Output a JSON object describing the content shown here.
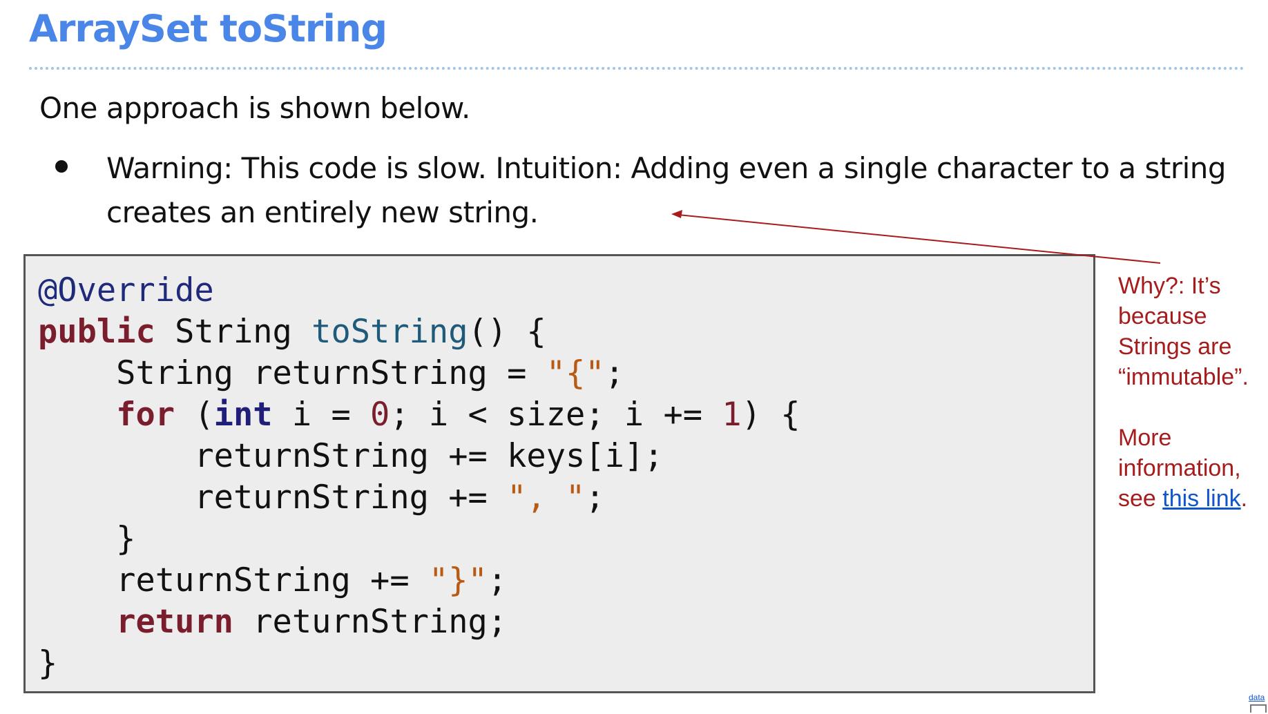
{
  "slide": {
    "title": "ArraySet toString",
    "intro": "One approach is shown below.",
    "bullets": [
      "Warning: This code is slow. Intuition: Adding even a single character to a string creates an entirely new string."
    ]
  },
  "code": {
    "lines": [
      [
        {
          "t": "annotation",
          "s": "@Override"
        }
      ],
      [
        {
          "t": "keyword",
          "s": "public"
        },
        {
          "t": "plain",
          "s": " String "
        },
        {
          "t": "method",
          "s": "toString"
        },
        {
          "t": "plain",
          "s": "() {"
        }
      ],
      [
        {
          "t": "plain",
          "s": "    String returnString = "
        },
        {
          "t": "string",
          "s": "\"{\""
        },
        {
          "t": "plain",
          "s": ";"
        }
      ],
      [
        {
          "t": "plain",
          "s": "    "
        },
        {
          "t": "keyword",
          "s": "for"
        },
        {
          "t": "plain",
          "s": " ("
        },
        {
          "t": "type",
          "s": "int"
        },
        {
          "t": "plain",
          "s": " i = "
        },
        {
          "t": "number",
          "s": "0"
        },
        {
          "t": "plain",
          "s": "; i < size; i += "
        },
        {
          "t": "number",
          "s": "1"
        },
        {
          "t": "plain",
          "s": ") {"
        }
      ],
      [
        {
          "t": "plain",
          "s": "        returnString += keys[i];"
        }
      ],
      [
        {
          "t": "plain",
          "s": "        returnString += "
        },
        {
          "t": "string",
          "s": "\", \""
        },
        {
          "t": "plain",
          "s": ";"
        }
      ],
      [
        {
          "t": "plain",
          "s": "    }"
        }
      ],
      [
        {
          "t": "plain",
          "s": "    returnString += "
        },
        {
          "t": "string",
          "s": "\"}\""
        },
        {
          "t": "plain",
          "s": ";"
        }
      ],
      [
        {
          "t": "plain",
          "s": "    "
        },
        {
          "t": "keyword",
          "s": "return"
        },
        {
          "t": "plain",
          "s": " returnString;"
        }
      ],
      [
        {
          "t": "plain",
          "s": "}"
        }
      ]
    ]
  },
  "side_note": {
    "why_text": "Why?: It’s because Strings are “immutable”.",
    "more_prefix": "More information, see ",
    "link_text": "this link",
    "more_suffix": "."
  },
  "corner": {
    "badge_text": "data"
  },
  "colors": {
    "title": "#4a86e8",
    "note": "#a61c1c",
    "link": "#1155cc",
    "code_bg": "#ededed"
  }
}
